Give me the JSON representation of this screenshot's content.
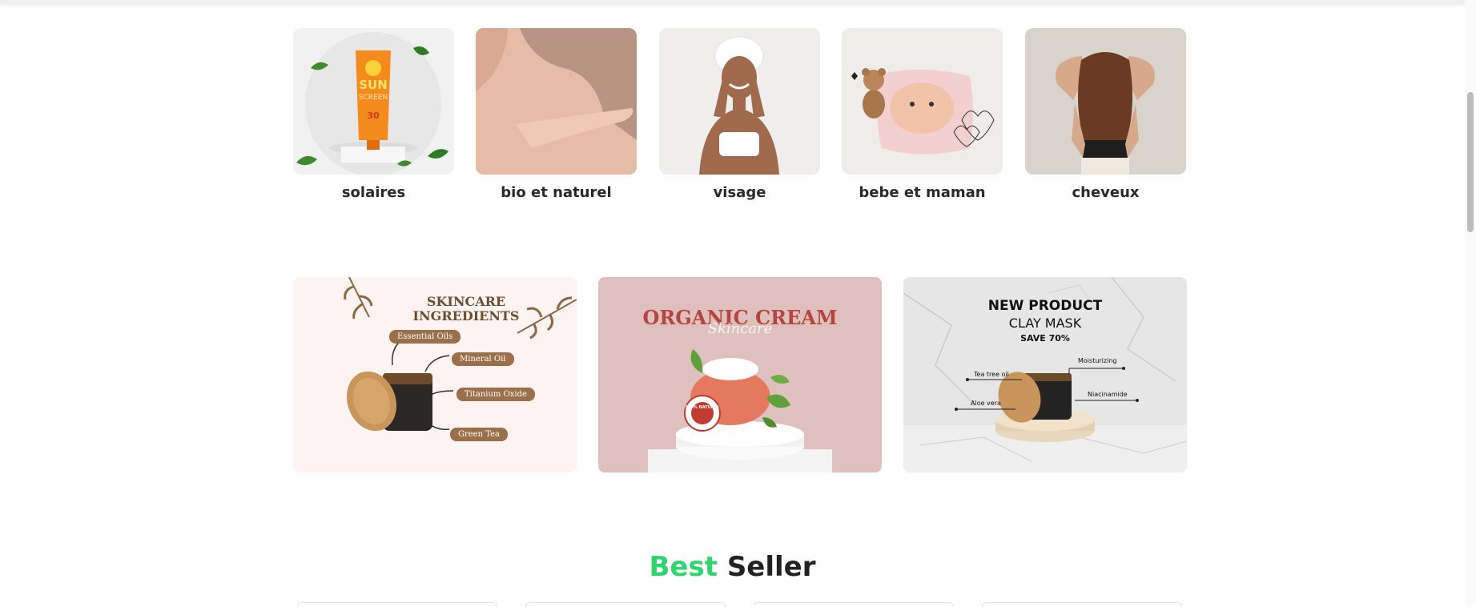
{
  "categories": [
    {
      "label": "solaires",
      "icon": "sunscreen-image"
    },
    {
      "label": "bio et naturel",
      "icon": "shoulder-hand-image"
    },
    {
      "label": "visage",
      "icon": "face-care-image"
    },
    {
      "label": "bebe et maman",
      "icon": "baby-image"
    },
    {
      "label": "cheveux",
      "icon": "hair-image"
    }
  ],
  "sunscreen": {
    "line1": "SUN",
    "line2": "SCREEN",
    "spf": "30"
  },
  "banner1": {
    "title1": "SKINCARE",
    "title2": "INGREDIENTS",
    "tags": [
      "Essential Oils",
      "Mineral Oil",
      "Titanium Oxide",
      "Green Tea"
    ]
  },
  "banner2": {
    "title": "ORGANIC CREAM",
    "script": "Skincare",
    "seal": "100% NATURAL"
  },
  "banner3": {
    "title": "NEW PRODUCT",
    "subtitle": "CLAY MASK",
    "offer": "SAVE 70%",
    "labels": [
      "Moisturizing",
      "Tea tree oil",
      "Niacinamide",
      "Aloe vera"
    ]
  },
  "section": {
    "title_accent": "Best",
    "title_rest": "Seller"
  },
  "colors": {
    "accent": "#2fd66f",
    "tag_brown": "#9b6f4a",
    "cream_title": "#b5463f"
  }
}
